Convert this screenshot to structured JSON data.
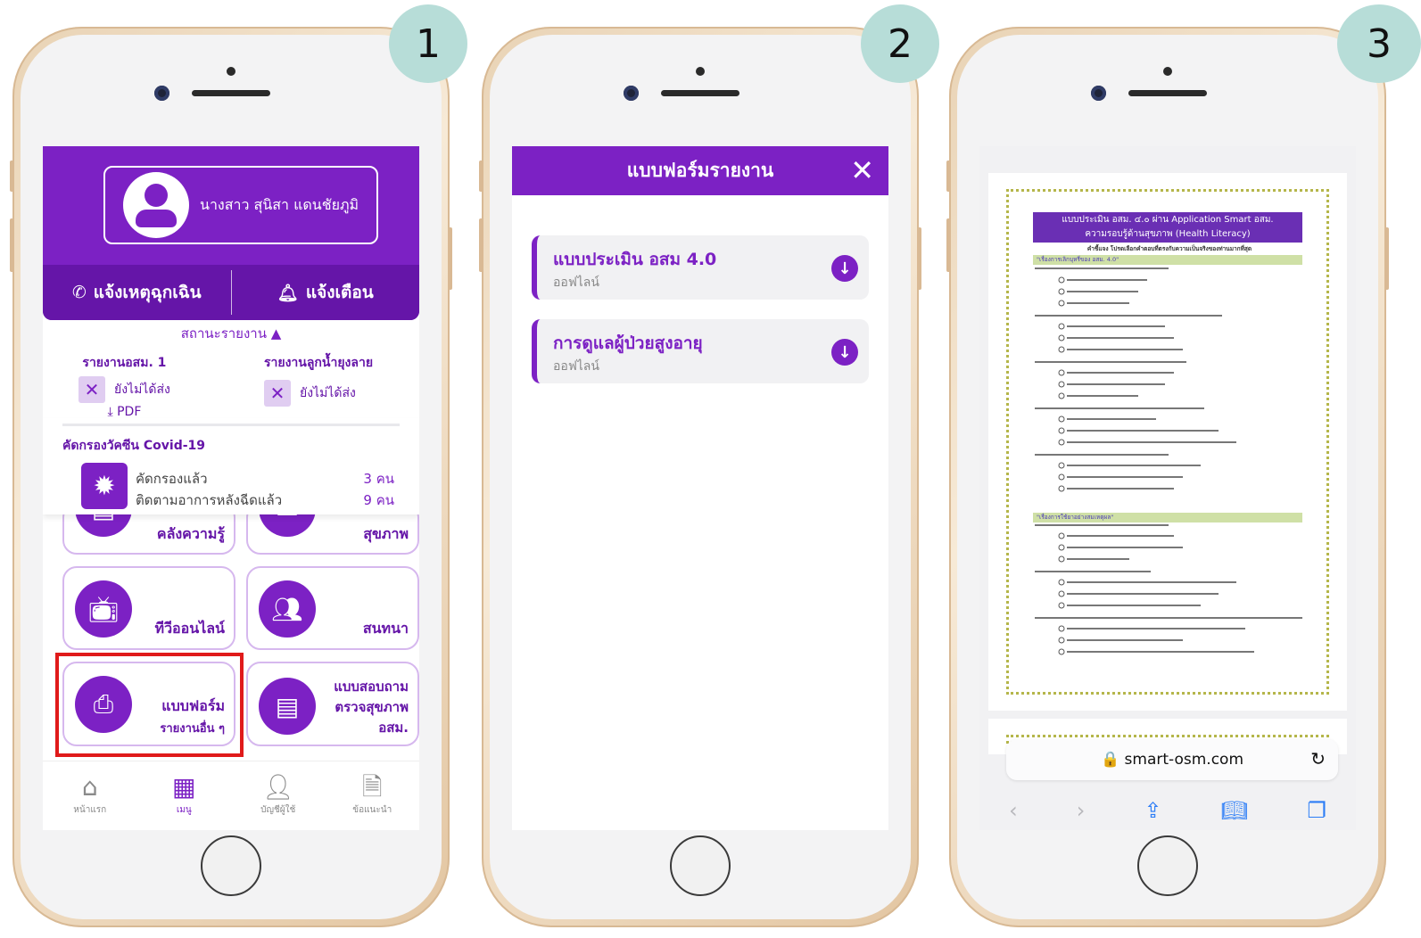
{
  "badges": [
    "1",
    "2",
    "3"
  ],
  "screen1": {
    "profile_name": "นางสาว สุนิสา แดนชัยภูมิ",
    "emergency_label": "แจ้งเหตุฉุกเฉิน",
    "alert_label": "แจ้งเตือน",
    "status_toggle": "สถานะรายงาน ▲",
    "report1_title": "รายงานอสม. 1",
    "report1_status": "ยังไม่ได้ส่ง",
    "report1_pdf": "⤓ PDF",
    "report2_title": "รายงานลูกน้ำยุงลาย",
    "report2_status": "ยังไม่ได้ส่ง",
    "covid_title": "คัดกรองวัคซีน Covid-19",
    "covid_rows": [
      {
        "label": "คัดกรองแล้ว",
        "value": "3 คน"
      },
      {
        "label": "ติดตามอาการหลังฉีดแล้ว",
        "value": "9 คน"
      }
    ],
    "tiles": {
      "knowledge": "คลังความรู้",
      "health": "สุขภาพ",
      "tv": "ทีวีออนไลน์",
      "chat": "สนทนา",
      "form_main": "แบบฟอร์ม",
      "form_sub": "รายงานอื่น ๆ",
      "survey_1": "แบบสอบถาม",
      "survey_2": "ตรวจสุขภาพ",
      "survey_3": "อสม."
    },
    "nav": [
      "หน้าแรก",
      "เมนู",
      "บัญชีผู้ใช้",
      "ข้อแนะนำ"
    ]
  },
  "screen2": {
    "title": "แบบฟอร์มรายงาน",
    "close": "✕",
    "cards": [
      {
        "title": "แบบประเมิน อสม 4.0",
        "subtitle": "ออฟไลน์"
      },
      {
        "title": "การดูแลผู้ป่วยสูงอายุ",
        "subtitle": "ออฟไลน์"
      }
    ]
  },
  "screen3": {
    "doc_header_1": "แบบประเมิน อสม. ๔.๐ ผ่าน Application Smart อสม.",
    "doc_header_2": "ความรอบรู้ด้านสุขภาพ (Health Literacy)",
    "doc_instruction": "คำชี้แจง โปรดเลือกคำตอบที่ตรงกับความเป็นจริงของท่านมากที่สุด",
    "section_1": "\"เรื่องการเลิกบุหรี่ของ อสม. 4.0\"",
    "section_2": "\"เรื่องการใช้ยาอย่างสมเหตุผล\"",
    "url": "🔒 smart-osm.com",
    "reload": "↻"
  },
  "colors": {
    "primary": "#7c21c4",
    "primary_dark": "#6515a8",
    "badge": "#b7ddd8",
    "highlight": "#e01a1a"
  }
}
